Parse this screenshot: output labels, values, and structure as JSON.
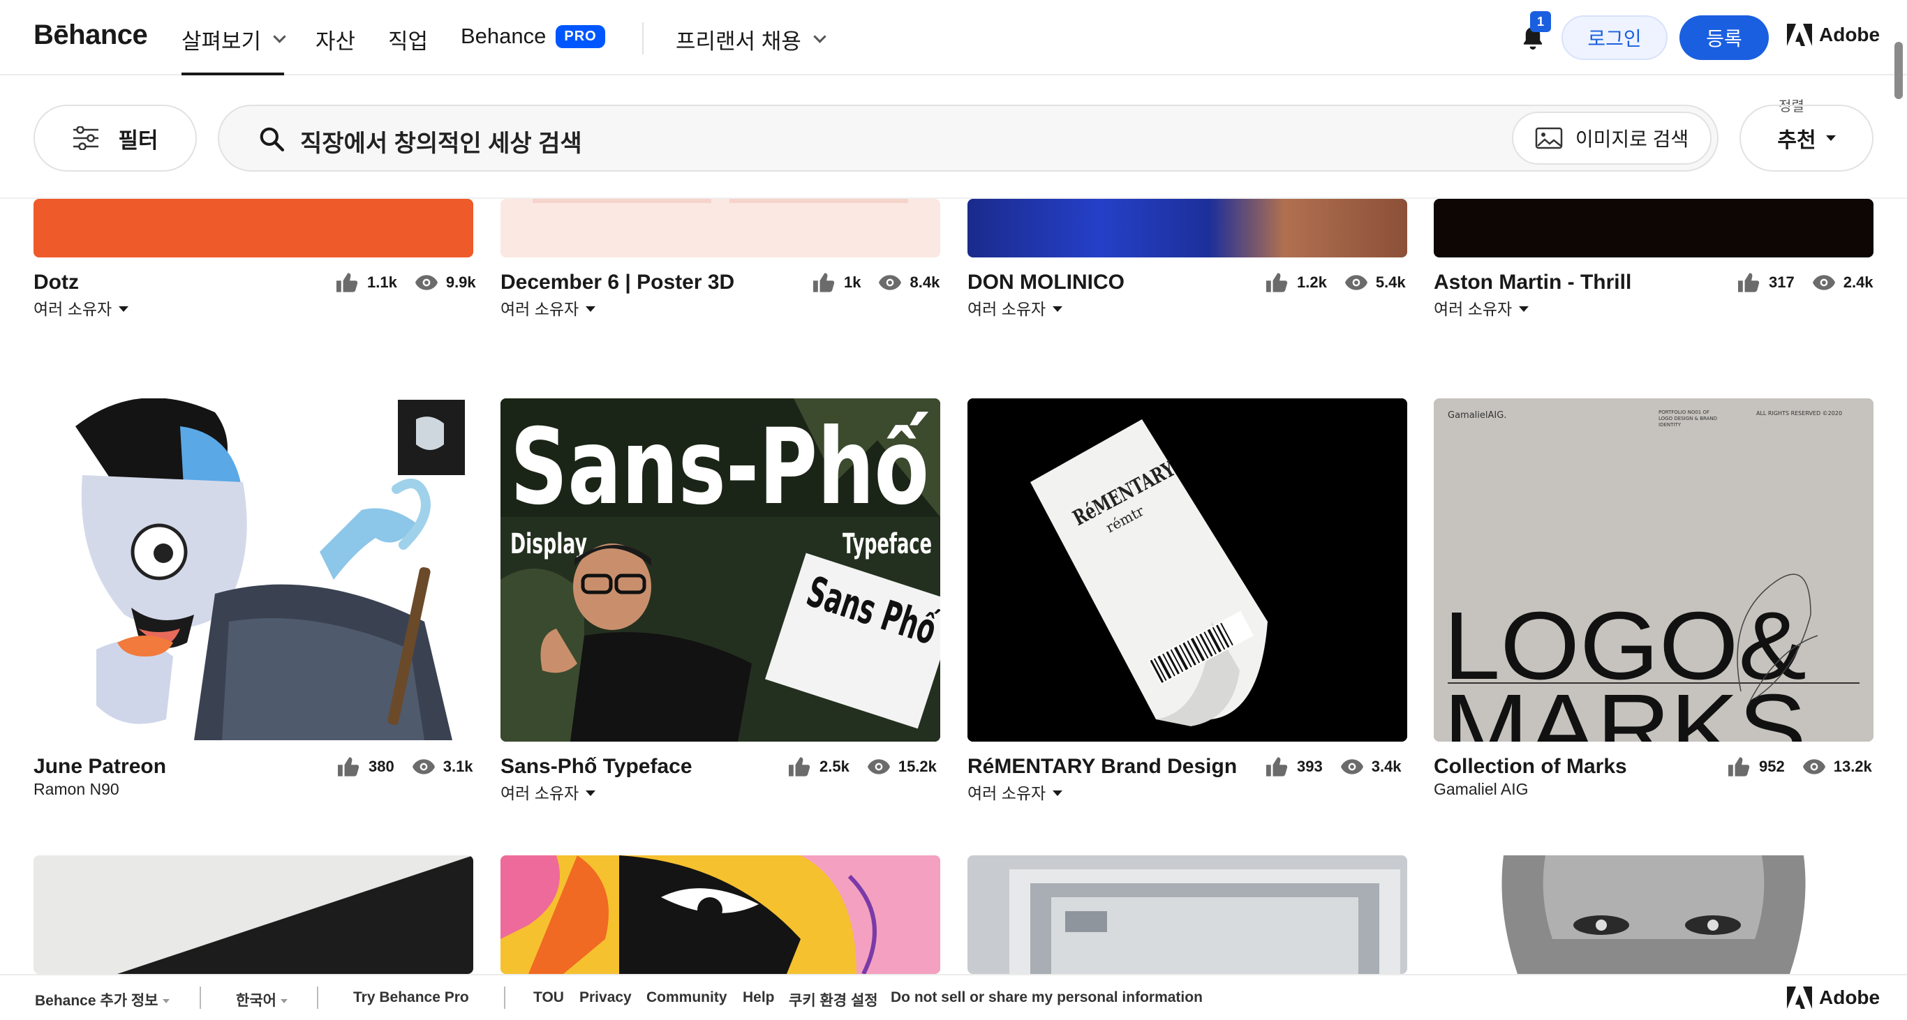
{
  "nav": {
    "logo": "Bēhance",
    "explore": "살펴보기",
    "assets": "자산",
    "jobs": "직업",
    "behance": "Behance",
    "pro_badge": "PRO",
    "hire_freelancer": "프리랜서 채용",
    "notification_count": "1",
    "login": "로그인",
    "signup": "등록",
    "adobe": "Adobe"
  },
  "search": {
    "filter_label": "필터",
    "placeholder": "직장에서 창의적인 세상 검색",
    "image_search": "이미지로 검색",
    "sort_label": "정렬",
    "sort_value": "추천"
  },
  "projects": [
    {
      "title": "Dotz",
      "owner": "여러 소유자",
      "multi_owner": true,
      "likes": "1.1k",
      "views": "9.9k"
    },
    {
      "title": "December 6 | Poster 3D",
      "owner": "여러 소유자",
      "multi_owner": true,
      "likes": "1k",
      "views": "8.4k"
    },
    {
      "title": "DON MOLINICO",
      "owner": "여러 소유자",
      "multi_owner": true,
      "likes": "1.2k",
      "views": "5.4k"
    },
    {
      "title": "Aston Martin - Thrill",
      "owner": "여러 소유자",
      "multi_owner": true,
      "likes": "317",
      "views": "2.4k"
    },
    {
      "title": "June Patreon",
      "owner": "Ramon N90",
      "multi_owner": false,
      "likes": "380",
      "views": "3.1k"
    },
    {
      "title": "Sans-Phố Typeface",
      "owner": "여러 소유자",
      "multi_owner": true,
      "likes": "2.5k",
      "views": "15.2k"
    },
    {
      "title": "RéMENTARY Brand Design",
      "owner": "여러 소유자",
      "multi_owner": true,
      "likes": "393",
      "views": "3.4k"
    },
    {
      "title": "Collection of Marks",
      "owner": "Gamaliel AIG",
      "multi_owner": false,
      "likes": "952",
      "views": "13.2k"
    }
  ],
  "thumb_text": {
    "sans_pho_title": "Sans-Phố",
    "sans_pho_display": "Display",
    "sans_pho_typeface": "Typeface",
    "sans_pho_sign": "Sans Phố",
    "rementary_brand": "RéMENTARY",
    "rementary_sub": "rémtr",
    "gamaliel_brand": "GamalielAIG.",
    "gamaliel_portfolio": "PORTFOLIO NO01 OF LOGO DESIGN & BRAND IDENTITY",
    "gamaliel_rights": "ALL RIGHTS RESERVED ©2020",
    "logo_marks_line1": "LOGO&",
    "logo_marks_line2": "MARKS"
  },
  "footer": {
    "more_info": "Behance 추가 정보",
    "language": "한국어",
    "try_pro": "Try Behance Pro",
    "tou": "TOU",
    "privacy": "Privacy",
    "community": "Community",
    "help": "Help",
    "cookie": "쿠키 환경 설정",
    "do_not_sell": "Do not sell or share my personal information",
    "adobe": "Adobe"
  }
}
